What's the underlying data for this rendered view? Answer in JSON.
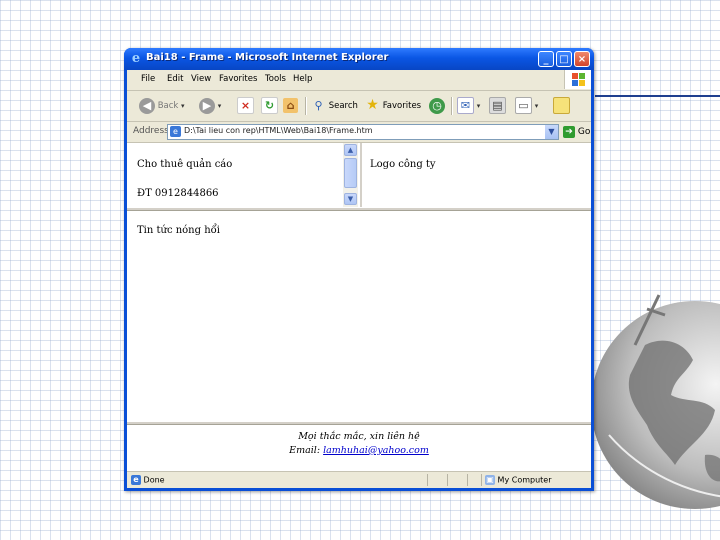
{
  "window": {
    "title": "Bai18 - Frame - Microsoft Internet Explorer"
  },
  "menu": [
    "File",
    "Edit",
    "View",
    "Favorites",
    "Tools",
    "Help"
  ],
  "toolbar": {
    "back": "Back",
    "search": "Search",
    "favorites": "Favorites"
  },
  "address": {
    "label": "Address",
    "value": "D:\\Tai lieu con rep\\HTML\\Web\\Bai18\\Frame.htm",
    "go": "Go"
  },
  "frames": {
    "top_left": {
      "line1": "Cho thuê quản cáo",
      "line2": "ĐT 0912844866"
    },
    "top_right": {
      "text": "Logo công ty"
    },
    "main": {
      "text": "Tin tức nóng hổi"
    },
    "bottom": {
      "line1": "Mọi thắc mắc, xin liên hệ",
      "email_label": "Email:",
      "email": "lamhuhai@yahoo.com"
    }
  },
  "status": {
    "left": "Done",
    "zone": "My Computer"
  },
  "colors": {
    "titlebar": "#0a56e4",
    "chrome": "#ece9d8",
    "link": "#0000cc",
    "deco_line": "#1f3f8f"
  }
}
